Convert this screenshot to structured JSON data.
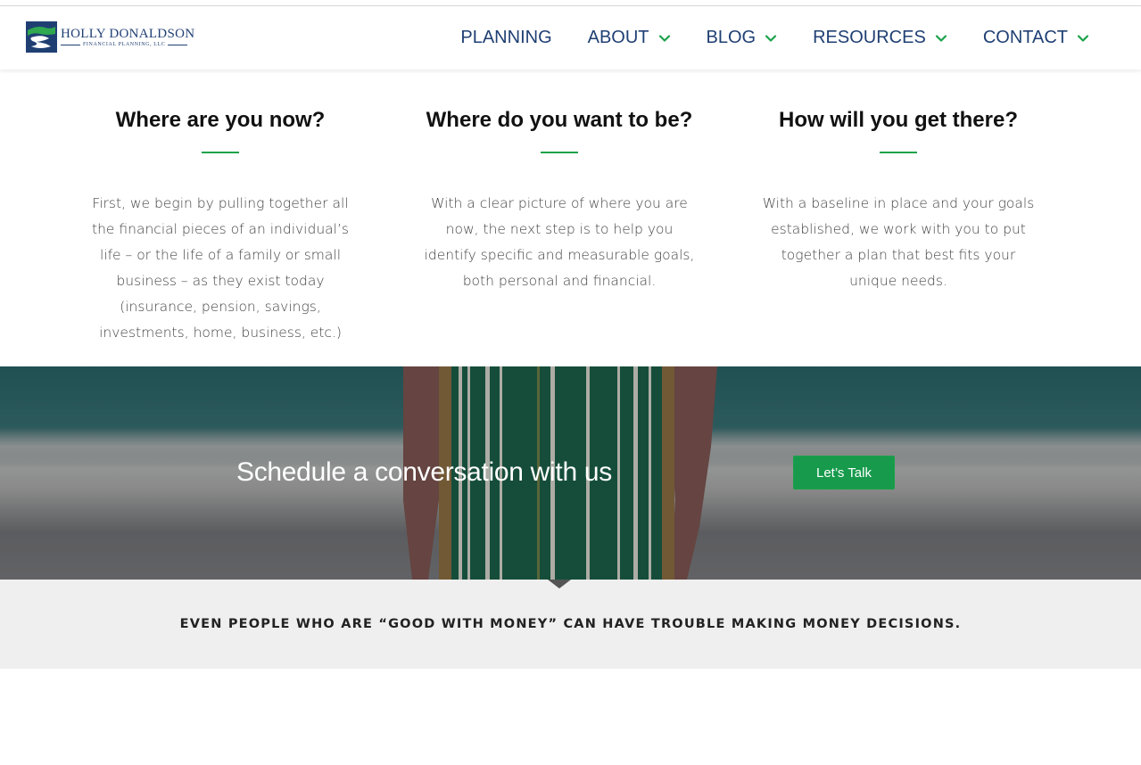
{
  "header": {
    "logo": {
      "name": "HOLLY DONALDSON",
      "subtitle": "FINANCIAL PLANNING, LLC"
    },
    "nav": [
      {
        "label": "PLANNING",
        "has_dropdown": false
      },
      {
        "label": "ABOUT",
        "has_dropdown": true
      },
      {
        "label": "BLOG",
        "has_dropdown": true
      },
      {
        "label": "RESOURCES",
        "has_dropdown": true
      },
      {
        "label": "CONTACT",
        "has_dropdown": true
      }
    ]
  },
  "steps": [
    {
      "title": "Where are you now?",
      "body": "First, we begin by pulling together all the financial pieces of an individual’s life – or the life of a family or small business – as they exist today (insurance, pension, savings, investments, home, business, etc.)"
    },
    {
      "title": "Where do you want to be?",
      "body": "With a clear picture of where you are now, the next step is to help you identify specific and measurable goals, both personal and financial."
    },
    {
      "title": "How will you get there?",
      "body": "With a baseline in place and your goals established, we work with you to put together a plan that best fits your unique needs."
    }
  ],
  "banner": {
    "title": "Schedule a conversation with us",
    "cta_label": "Let’s Talk"
  },
  "tagline": "EVEN PEOPLE WHO ARE “GOOD WITH MONEY” CAN HAVE TROUBLE MAKING MONEY DECISIONS.",
  "colors": {
    "brand_navy": "#1f3f73",
    "accent_green": "#1aa24a",
    "cta_green": "#179a4c",
    "tagline_bg": "#efefef"
  }
}
